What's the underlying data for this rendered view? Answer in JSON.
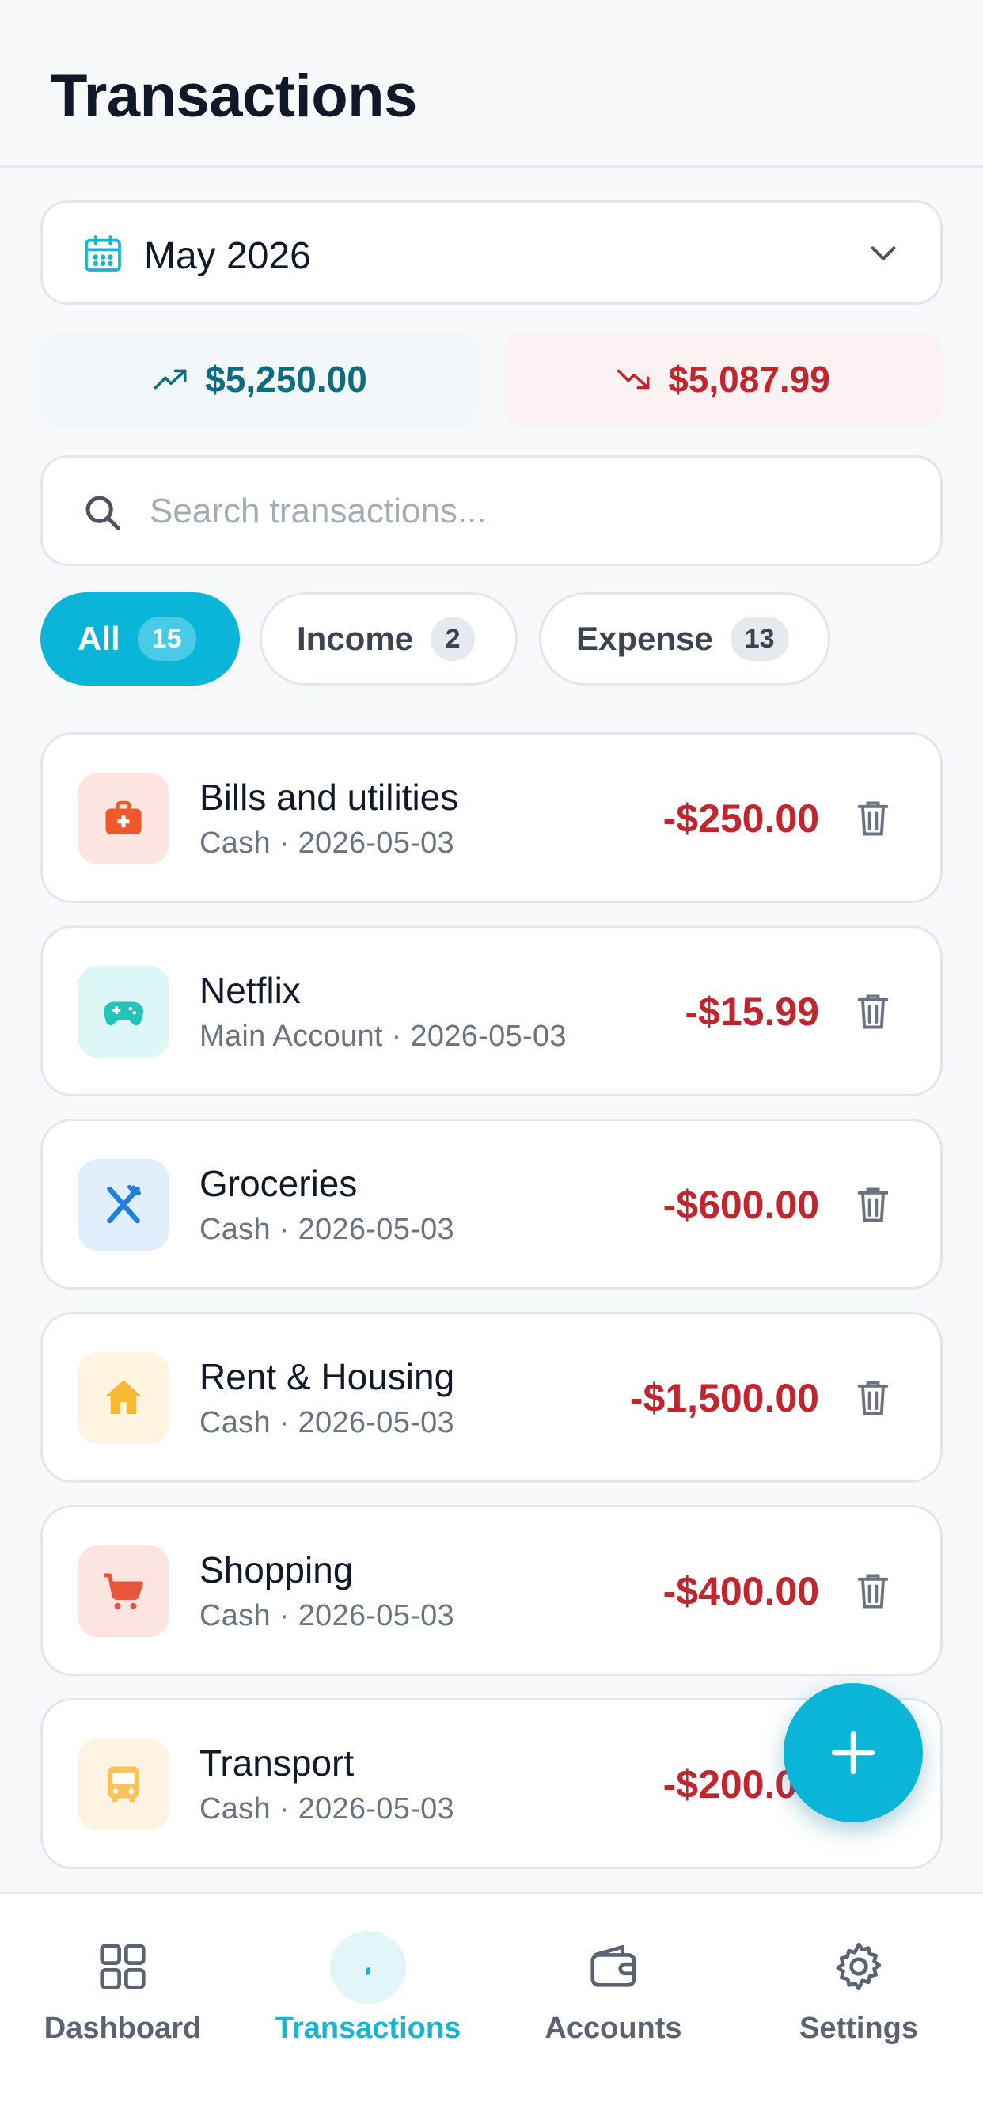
{
  "header": {
    "title": "Transactions"
  },
  "month_selector": {
    "label": "May 2026",
    "icon": "calendar-icon"
  },
  "summary": {
    "income": "$5,250.00",
    "expense": "$5,087.99",
    "colors": {
      "income": "#0f6c80",
      "expense": "#c0262d"
    }
  },
  "search": {
    "placeholder": "Search transactions..."
  },
  "filters": [
    {
      "label": "All",
      "count": "15",
      "active": true
    },
    {
      "label": "Income",
      "count": "2",
      "active": false
    },
    {
      "label": "Expense",
      "count": "13",
      "active": false
    }
  ],
  "transactions": [
    {
      "name": "Bills and utilities",
      "meta": "Cash · 2026-05-03",
      "amount": "-$250.00",
      "icon": "medkit-icon"
    },
    {
      "name": "Netflix",
      "meta": "Main Account · 2026-05-03",
      "amount": "-$15.99",
      "icon": "gamepad-icon"
    },
    {
      "name": "Groceries",
      "meta": "Cash · 2026-05-03",
      "amount": "-$600.00",
      "icon": "utensils-icon"
    },
    {
      "name": "Rent & Housing",
      "meta": "Cash · 2026-05-03",
      "amount": "-$1,500.00",
      "icon": "house-icon"
    },
    {
      "name": "Shopping",
      "meta": "Cash · 2026-05-03",
      "amount": "-$400.00",
      "icon": "cart-icon"
    },
    {
      "name": "Transport",
      "meta": "Cash · 2026-05-03",
      "amount": "-$200.00",
      "icon": "bus-icon"
    }
  ],
  "nav": [
    {
      "label": "Dashboard",
      "icon": "grid-icon",
      "active": false
    },
    {
      "label": "Transactions",
      "icon": "transactions-icon",
      "active": true
    },
    {
      "label": "Accounts",
      "icon": "wallet-icon",
      "active": false
    },
    {
      "label": "Settings",
      "icon": "gear-icon",
      "active": false
    }
  ],
  "theme": {
    "accent": "#0bb5d8",
    "danger": "#c0262d"
  }
}
